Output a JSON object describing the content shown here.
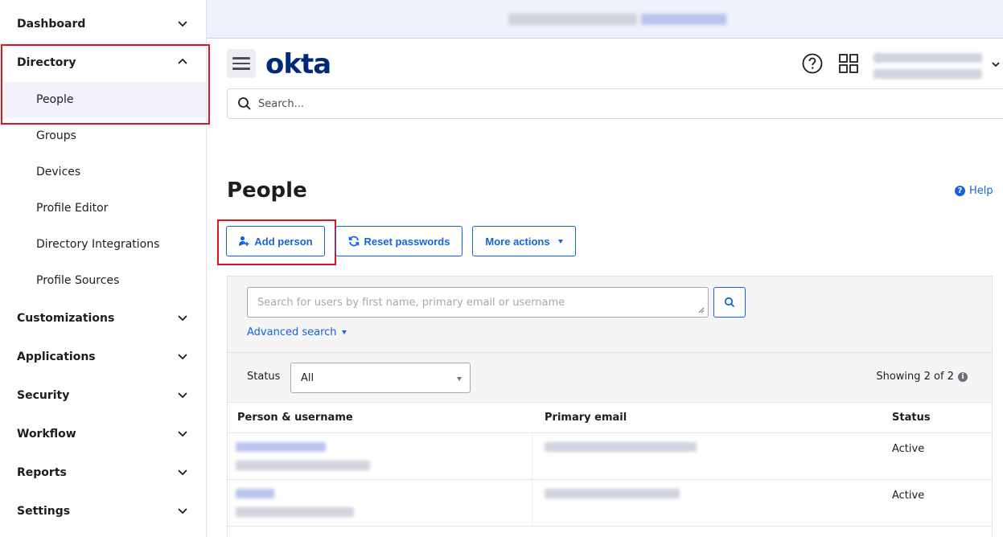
{
  "sidebar": {
    "items": [
      {
        "label": "Dashboard",
        "expanded": false
      },
      {
        "label": "Directory",
        "expanded": true
      },
      {
        "label": "Customizations",
        "expanded": false
      },
      {
        "label": "Applications",
        "expanded": false
      },
      {
        "label": "Security",
        "expanded": false
      },
      {
        "label": "Workflow",
        "expanded": false
      },
      {
        "label": "Reports",
        "expanded": false
      },
      {
        "label": "Settings",
        "expanded": false
      }
    ],
    "directory_children": [
      {
        "label": "People",
        "active": true
      },
      {
        "label": "Groups"
      },
      {
        "label": "Devices"
      },
      {
        "label": "Profile Editor"
      },
      {
        "label": "Directory Integrations"
      },
      {
        "label": "Profile Sources"
      }
    ]
  },
  "header": {
    "logo": "okta",
    "search_placeholder": "Search...",
    "icons": [
      "help-circle-icon",
      "apps-grid-icon",
      "chevron-down-icon"
    ]
  },
  "page": {
    "title": "People",
    "help_label": "Help",
    "buttons": {
      "add_person": "Add person",
      "reset_passwords": "Reset passwords",
      "more_actions": "More actions"
    },
    "user_search_placeholder": "Search for users by first name, primary email or username",
    "advanced_search": "Advanced search",
    "status_label": "Status",
    "status_value": "All",
    "showing": "Showing 2 of 2",
    "table": {
      "columns": [
        "Person & username",
        "Primary email",
        "Status"
      ],
      "rows": [
        {
          "status": "Active"
        },
        {
          "status": "Active"
        }
      ]
    }
  },
  "colors": {
    "accent": "#1662dd",
    "brand": "#00297a",
    "highlight": "#e0141e"
  }
}
